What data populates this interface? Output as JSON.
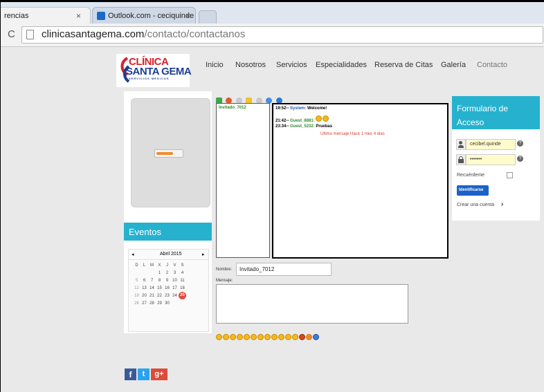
{
  "browser": {
    "tabs": [
      {
        "label": "rencias",
        "close": "×"
      },
      {
        "label": "Outlook.com - ceciquinde",
        "close": "×"
      }
    ],
    "url_host": "clinicasantagema.com",
    "url_path": "/contacto/contactanos"
  },
  "logo": {
    "line1": "CLÍNICA",
    "line2": "SANTA GEMA",
    "line3": "SERVICIOS MEDICOS"
  },
  "nav": [
    "Inicio",
    "Nosotros",
    "Servicios",
    "Especialidades",
    "Reserva de Citas",
    "Galería",
    "Contacto"
  ],
  "eventos": {
    "title": "Eventos",
    "calendar": {
      "month": "Abril 2015",
      "prev": "◂",
      "next": "▸",
      "weekdays": [
        "D",
        "L",
        "M",
        "X",
        "J",
        "V",
        "S"
      ],
      "weeks": [
        [
          "",
          "",
          "",
          "1",
          "2",
          "3",
          "4"
        ],
        [
          "5",
          "6",
          "7",
          "8",
          "9",
          "10",
          "11"
        ],
        [
          "12",
          "13",
          "14",
          "15",
          "16",
          "17",
          "18"
        ],
        [
          "19",
          "20",
          "21",
          "22",
          "23",
          "24",
          "25"
        ],
        [
          "26",
          "27",
          "28",
          "29",
          "30",
          "",
          ""
        ]
      ],
      "today": "25"
    }
  },
  "chat": {
    "users": [
      "Invitado_7012"
    ],
    "messages": [
      {
        "time": "19:52--",
        "user": "System:",
        "text": "Welcome!"
      },
      {
        "time": "21:42--",
        "user": "Guest_8881:",
        "text": ""
      },
      {
        "time": "23:34--",
        "user": "Guest_5232:",
        "text": "Pruebas"
      }
    ],
    "last_message": "Ultimo mensaje Hace 1 mes 4 dias",
    "name_label": "Nombre:",
    "name_value": "Invitado_7012",
    "message_label": "Mensaje:",
    "message_value": ""
  },
  "login": {
    "title": "Formulario de Acceso",
    "username": "cecibel.quinde",
    "password": "•••••••",
    "remember": "Recuérdeme",
    "submit": "Identificarse",
    "create": "Crear una cuenta"
  },
  "social": {
    "facebook": "f",
    "twitter": "t",
    "googleplus": "g+"
  },
  "colors": {
    "teal": "#26b2cf",
    "login_button": "#1a62c7",
    "today": "#e8473a",
    "chat_border": "#000000"
  }
}
